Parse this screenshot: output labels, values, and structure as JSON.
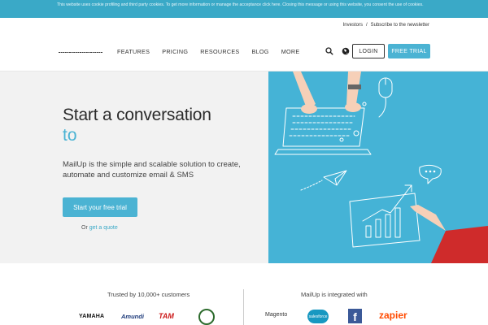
{
  "cookie_bar": {
    "text": "This website uses cookie profiling and third party cookies. To get more information or manage the acceptance click here. Closing this message or using this website, you consent the use of cookies."
  },
  "header": {
    "top_links": [
      "Investors",
      "/",
      "Subscribe to the newsletter"
    ],
    "nav": [
      "FEATURES",
      "PRICING",
      "RESOURCES",
      "BLOG",
      "MORE"
    ],
    "icons": [
      "search-icon",
      "globe-icon"
    ],
    "login_label": "LOGIN",
    "trial_label": "FREE TRIAL"
  },
  "hero": {
    "title_line1": "Start a conversation",
    "title_line2": "to",
    "description": "MailUp is the simple and scalable solution to create, automate and customize email & SMS",
    "cta_label": "Start your free trial",
    "quote_prefix": "Or",
    "quote_link": "get a quote"
  },
  "trusted": {
    "title": "Trusted by 10,000+ customers",
    "logos": [
      "YAMAHA",
      "Amundi",
      "TAM"
    ]
  },
  "integrations": {
    "title": "MailUp is integrated with",
    "logos": [
      "Magento",
      "salesforce",
      "f",
      "zapier"
    ]
  },
  "colors": {
    "accent": "#4bb3d3",
    "cookie_bar": "#3aa9c7",
    "hero_right_bg": "#45b3d6",
    "hero_left_bg": "#f2f2f2"
  }
}
